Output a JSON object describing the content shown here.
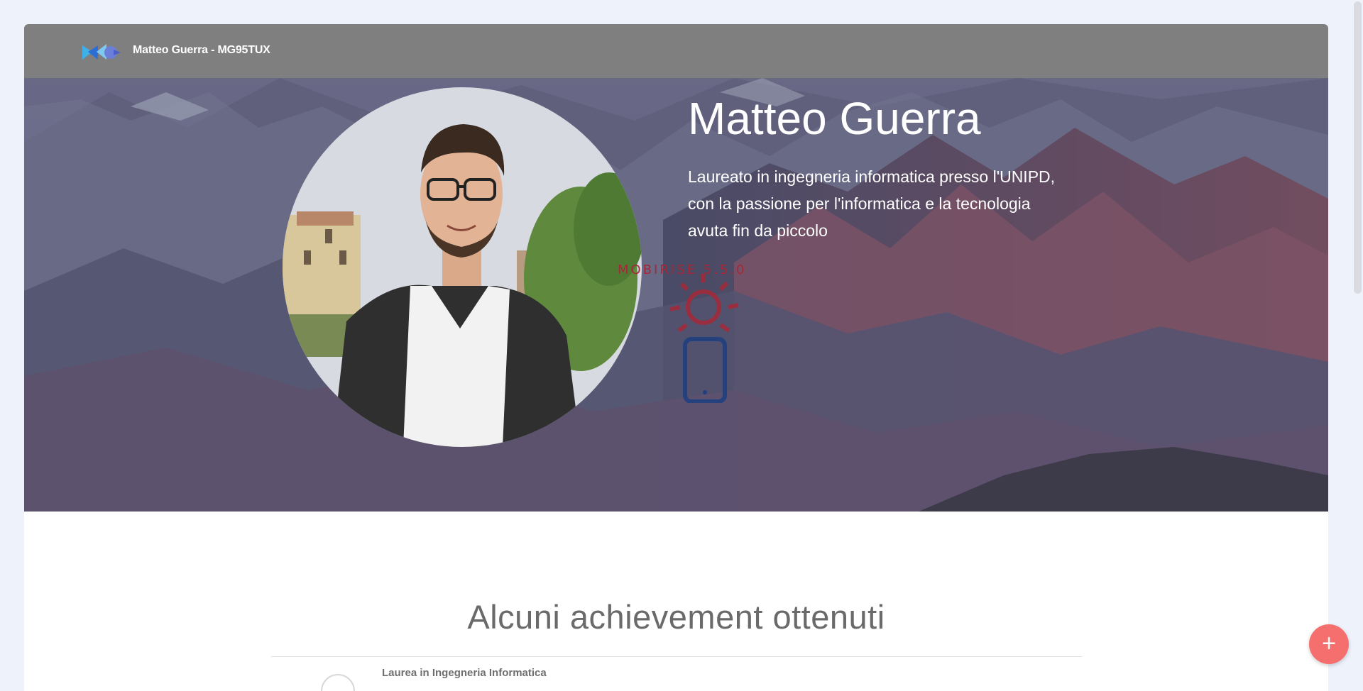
{
  "navbar": {
    "brand_name": "Matteo Guerra - MG95TUX",
    "logo_icon": "mobirise-logo-icon"
  },
  "hero": {
    "title": "Matteo Guerra",
    "text": "Laureato in ingegneria informatica presso l'UNIPD, con la passione per l'informatica e la tecnologia avuta fin da piccolo",
    "portrait_icon": "profile-photo",
    "watermark_text": "MOBIRISE 5.5.0",
    "watermark_icon": "sun-phone-icon"
  },
  "achievements": {
    "title": "Alcuni achievement ottenuti",
    "items": [
      {
        "title": "Laurea in Ingegneria Informatica"
      }
    ]
  },
  "fab": {
    "label": "+",
    "icon": "plus-icon"
  },
  "colors": {
    "navbar_bg": "#7f7f7f",
    "fab_bg": "#f66f6f",
    "page_bg": "#eef2fb",
    "watermark": "#a62838"
  }
}
